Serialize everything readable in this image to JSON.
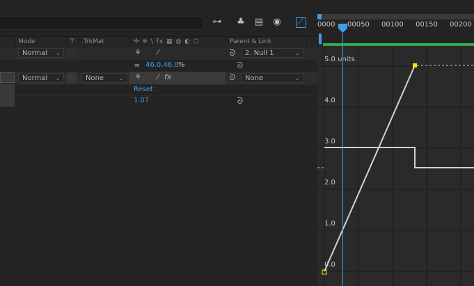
{
  "header": {
    "columns": {
      "mode": "Mode",
      "t": "T",
      "trkmat": ".TrkMat",
      "switches": "✣ ✵ \\ fx ▦ ◍ ◐ ⬡",
      "parent": "Parent & Link"
    }
  },
  "rows": [
    {
      "mode": "Normal",
      "parent": "2. Null 1"
    },
    {
      "scale_value": "46.0,46.0",
      "scale_unit": "%"
    },
    {
      "mode": "Normal",
      "trkmat": "None",
      "parent": "None"
    },
    {
      "reset_label": "Reset"
    },
    {
      "value": "1.07"
    }
  ],
  "ruler": {
    "ticks": [
      "0000",
      "00050",
      "00100",
      "00150",
      "00200"
    ]
  },
  "graph": {
    "y_labels": [
      "5.0 units",
      "4.0",
      "3.0",
      "2.0",
      "1.0",
      "0.0"
    ]
  },
  "colors": {
    "accent": "#3d9de6",
    "keyframe": "#f5e10d",
    "work_area": "#33a84a"
  },
  "icons": [
    "flowchart-icon",
    "solo-icon",
    "frame-blend-icon",
    "motion-blur-icon",
    "graph-editor-icon",
    "pickwhip-icon",
    "link-icon"
  ]
}
